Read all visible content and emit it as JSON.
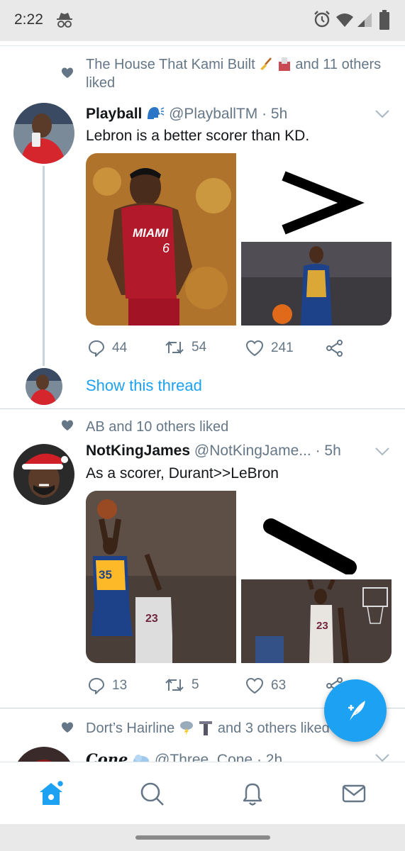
{
  "status_bar": {
    "time": "2:22",
    "icons": [
      "incognito-icon",
      "alarm-icon",
      "wifi-icon",
      "signal-icon",
      "battery-icon"
    ]
  },
  "colors": {
    "accent": "#1da1f2",
    "secondary_text": "#657786",
    "primary_text": "#14171a"
  },
  "tweets": [
    {
      "social_context": {
        "prefix": "The House That Kami Built",
        "emoji": [
          "broom-emoji",
          "ballot-emoji"
        ],
        "suffix": "and 11 others",
        "line2": "liked"
      },
      "name": "Playball",
      "name_emoji": "speaking-head-emoji",
      "handle": "@PlayballTM",
      "time": "· 5h",
      "text": "Lebron is a better scorer than KD.",
      "media": [
        "lebron-miami-photo",
        "greater-than-sign-image",
        "durant-warriors-photo"
      ],
      "actions": {
        "replies": "44",
        "retweets": "54",
        "likes": "241"
      },
      "show_thread": "Show this thread"
    },
    {
      "social_context": {
        "prefix": "AB and 10 others liked"
      },
      "name": "NotKingJames",
      "handle": "@NotKingJame...",
      "time": "· 5h",
      "text": "As a scorer, Durant>>LeBron",
      "media": [
        "durant-shooting-photo",
        "slash-stroke-image",
        "lebron-layup-photo"
      ],
      "actions": {
        "replies": "13",
        "retweets": "5",
        "likes": "63"
      }
    },
    {
      "social_context": {
        "prefix": "Dort’s Hairline",
        "emoji": [
          "lightning-cloud-emoji",
          "dagger-emoji"
        ],
        "suffix": "and 3 others liked"
      },
      "name": "Cone",
      "handle": "@Three_Cone",
      "time": "· 2h"
    }
  ],
  "nav": [
    "home-icon",
    "search-icon",
    "notifications-icon",
    "messages-icon"
  ]
}
